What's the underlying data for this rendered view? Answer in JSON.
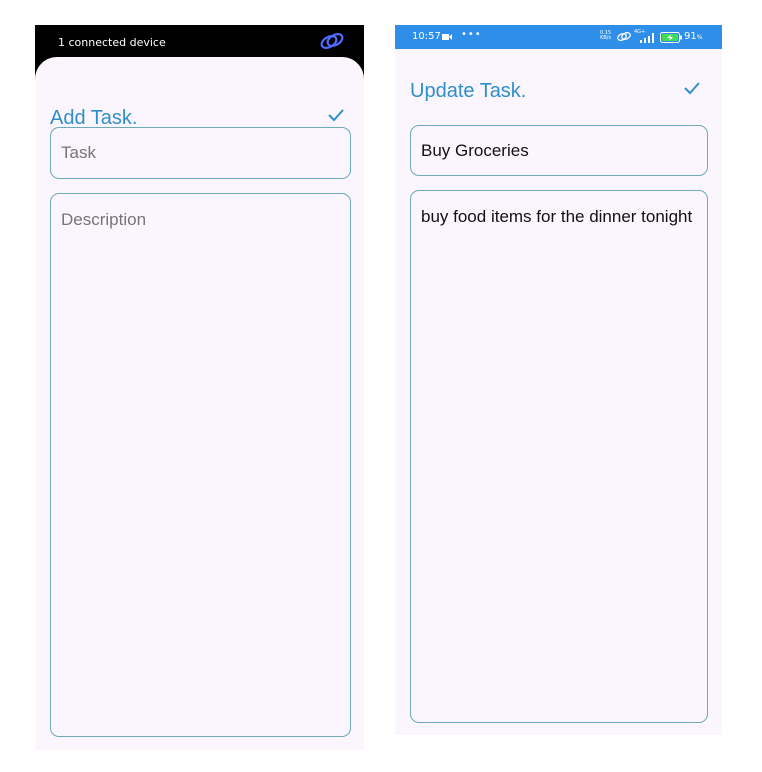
{
  "add_screen": {
    "status_bar": {
      "text": "1 connected device",
      "icon": "link-icon"
    },
    "title": "Add Task.",
    "confirm_icon": "check-icon",
    "task_field": {
      "placeholder": "Task",
      "value": ""
    },
    "description_field": {
      "placeholder": "Description",
      "value": ""
    }
  },
  "update_screen": {
    "status_bar": {
      "time": "10:57",
      "dots": "•••",
      "net_speed_value": "0.15",
      "net_speed_unit": "KB/s",
      "network_type": "4G+",
      "battery": "91"
    },
    "title": "Update Task.",
    "confirm_icon": "check-icon",
    "task_field": {
      "value": "Buy Groceries"
    },
    "description_field": {
      "value": "buy food items for the dinner tonight"
    }
  },
  "colors": {
    "accent": "#2f8fca",
    "border": "#6ea9b6",
    "screen_background": "#fbf6fd",
    "status_bar_blue": "#2f8fe8"
  }
}
